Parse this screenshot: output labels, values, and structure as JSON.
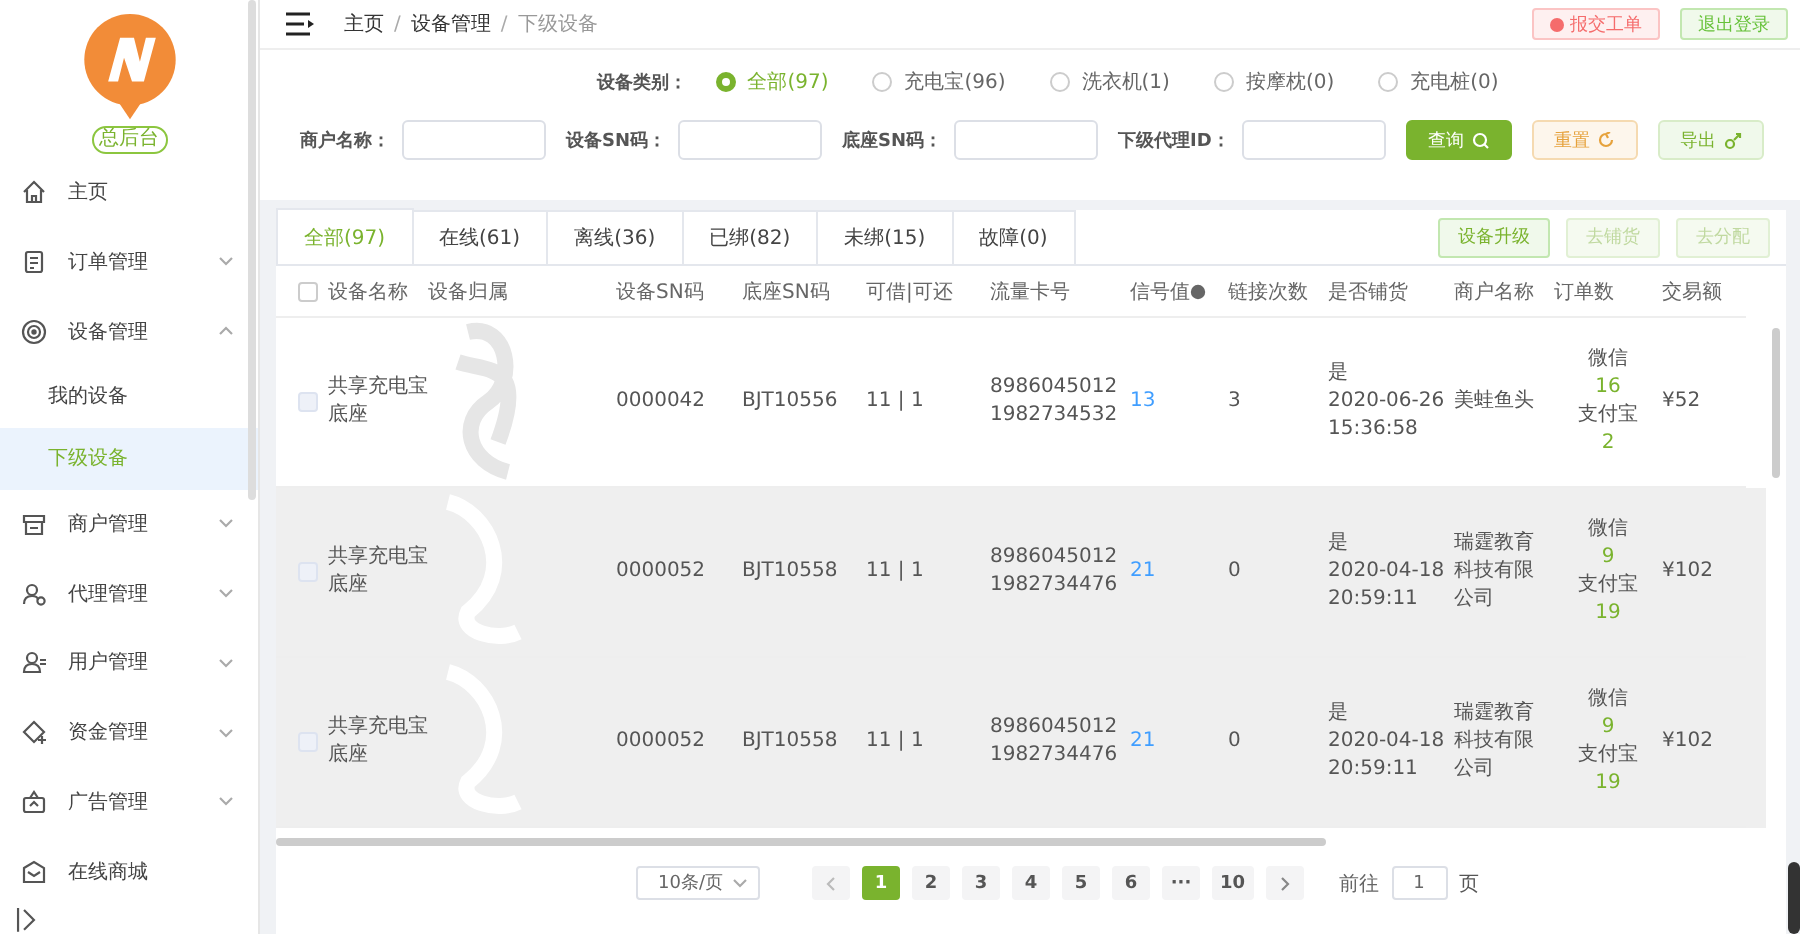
{
  "sidebar": {
    "badge": "总后台",
    "items": [
      {
        "label": "主页"
      },
      {
        "label": "订单管理",
        "expanded": false
      },
      {
        "label": "设备管理",
        "expanded": true,
        "children": [
          {
            "label": "我的设备",
            "selected": false
          },
          {
            "label": "下级设备",
            "selected": true
          }
        ]
      },
      {
        "label": "商户管理",
        "expanded": false
      },
      {
        "label": "代理管理",
        "expanded": false
      },
      {
        "label": "用户管理",
        "expanded": false
      },
      {
        "label": "资金管理",
        "expanded": false
      },
      {
        "label": "广告管理",
        "expanded": false
      },
      {
        "label": "在线商城"
      }
    ]
  },
  "header": {
    "breadcrumb": [
      "主页",
      "设备管理",
      "下级设备"
    ],
    "separator": "/",
    "buttons": [
      {
        "label": "报交工单",
        "kind": "danger"
      },
      {
        "label": "退出登录",
        "kind": "success"
      }
    ]
  },
  "filters": {
    "category_label": "设备类别：",
    "categories": [
      {
        "label": "全部(97)",
        "selected": true
      },
      {
        "label": "充电宝(96)",
        "selected": false
      },
      {
        "label": "洗衣机(1)",
        "selected": false
      },
      {
        "label": "按摩枕(0)",
        "selected": false
      },
      {
        "label": "充电桩(0)",
        "selected": false
      }
    ],
    "fields": [
      {
        "label": "商户名称："
      },
      {
        "label": "设备SN码："
      },
      {
        "label": "底座SN码："
      },
      {
        "label": "下级代理ID："
      }
    ],
    "actions": [
      {
        "label": "查询",
        "kind": "primary"
      },
      {
        "label": "重置",
        "kind": "warning"
      },
      {
        "label": "导出",
        "kind": "plain"
      }
    ]
  },
  "tabs": [
    {
      "label": "全部(97)",
      "selected": true
    },
    {
      "label": "在线(61)",
      "selected": false
    },
    {
      "label": "离线(36)",
      "selected": false
    },
    {
      "label": "已绑(82)",
      "selected": false
    },
    {
      "label": "未绑(15)",
      "selected": false
    },
    {
      "label": "故障(0)",
      "selected": false
    }
  ],
  "tab_actions": [
    {
      "label": "设备升级",
      "disabled": false
    },
    {
      "label": "去铺货",
      "disabled": true
    },
    {
      "label": "去分配",
      "disabled": true
    }
  ],
  "table": {
    "select_all_checked": false,
    "columns": [
      "设备名称",
      "设备归属",
      "设备SN码",
      "底座SN码",
      "可借|可还",
      "流量卡号",
      "信号值",
      "链接次数",
      "是否铺货",
      "商户名称",
      "订单数",
      "交易额"
    ],
    "rows": [
      {
        "checked": false,
        "highlighted": false,
        "name": "共享充电宝底座",
        "sn": "0000042",
        "base_sn": "BJT10556",
        "borrow_return": "11 | 1",
        "card": [
          "8986045012",
          "1982734532"
        ],
        "signal": "13",
        "connections": "3",
        "deployed": [
          "是",
          "2020-06-26",
          "15:36:58"
        ],
        "merchant": "美蛙鱼头",
        "orders": [
          "微信",
          "16",
          "支付宝",
          "2"
        ],
        "amount": "¥52"
      },
      {
        "checked": false,
        "highlighted": true,
        "name": "共享充电宝底座",
        "sn": "0000052",
        "base_sn": "BJT10558",
        "borrow_return": "11 | 1",
        "card": [
          "8986045012",
          "1982734476"
        ],
        "signal": "21",
        "connections": "0",
        "deployed": [
          "是",
          "2020-04-18",
          "20:59:11"
        ],
        "merchant": "瑞霆教育科技有限公司",
        "orders": [
          "微信",
          "9",
          "支付宝",
          "19"
        ],
        "amount": "¥102"
      },
      {
        "checked": false,
        "highlighted": true,
        "name": "共享充电宝底座",
        "sn": "0000052",
        "base_sn": "BJT10558",
        "borrow_return": "11 | 1",
        "card": [
          "8986045012",
          "1982734476"
        ],
        "signal": "21",
        "connections": "0",
        "deployed": [
          "是",
          "2020-04-18",
          "20:59:11"
        ],
        "merchant": "瑞霆教育科技有限公司",
        "orders": [
          "微信",
          "9",
          "支付宝",
          "19"
        ],
        "amount": "¥102"
      }
    ]
  },
  "pagination": {
    "page_size": "10条/页",
    "pages": [
      {
        "label": "1",
        "selected": true
      },
      {
        "label": "2",
        "selected": false
      },
      {
        "label": "3",
        "selected": false
      },
      {
        "label": "4",
        "selected": false
      },
      {
        "label": "5",
        "selected": false
      },
      {
        "label": "6",
        "selected": false
      },
      {
        "label": "···",
        "selected": false
      },
      {
        "label": "10",
        "selected": false
      }
    ],
    "goto_label": "前往",
    "goto_value": "1",
    "page_unit": "页"
  }
}
